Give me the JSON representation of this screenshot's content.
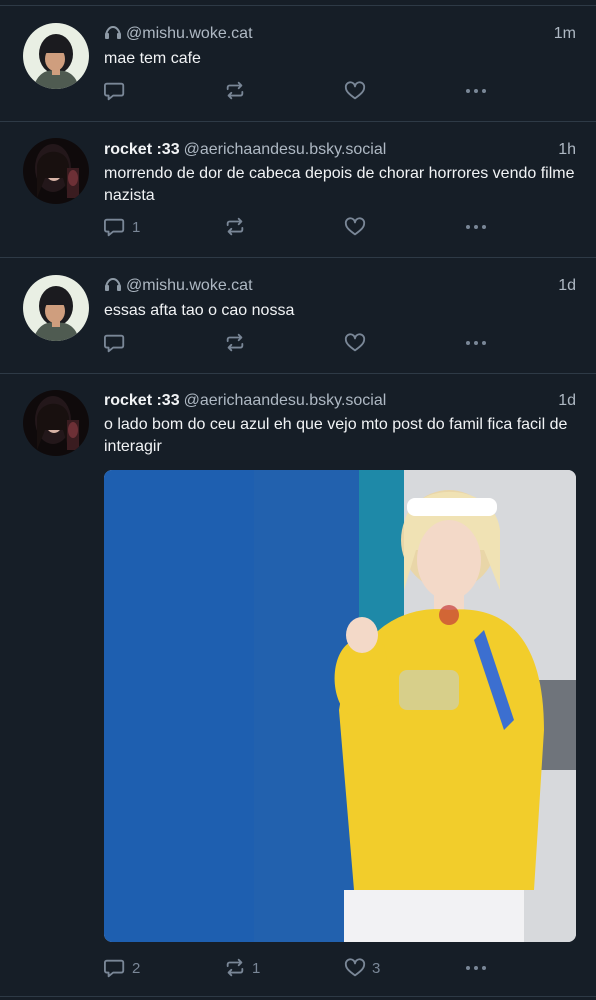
{
  "posts": [
    {
      "display_name": "",
      "handle": "@mishu.woke.cat",
      "time": "1m",
      "text": "mae tem cafe",
      "reply_count": "",
      "repost_count": "",
      "like_count": "",
      "avatar": "avatar-mishu",
      "has_badge_icon": true
    },
    {
      "display_name": "rocket :33",
      "handle": "@aerichaandesu.bsky.social",
      "time": "1h",
      "text": "morrendo de dor de cabeca depois de chorar horrores vendo filme nazista",
      "reply_count": "1",
      "repost_count": "",
      "like_count": "",
      "avatar": "avatar-rocket",
      "has_badge_icon": false
    },
    {
      "display_name": "",
      "handle": "@mishu.woke.cat",
      "time": "1d",
      "text": "essas afta tao o cao nossa",
      "reply_count": "",
      "repost_count": "",
      "like_count": "",
      "avatar": "avatar-mishu",
      "has_badge_icon": true
    },
    {
      "display_name": "rocket :33",
      "handle": "@aerichaandesu.bsky.social",
      "time": "1d",
      "text": "o lado bom do ceu azul eh que vejo mto post do famil fica facil de interagir",
      "reply_count": "2",
      "repost_count": "1",
      "like_count": "3",
      "avatar": "avatar-rocket",
      "has_badge_icon": false,
      "media": "gif-image"
    }
  ],
  "icons": {
    "reply": "reply-icon",
    "repost": "repost-icon",
    "like": "heart-icon",
    "more": "more-icon"
  },
  "colors": {
    "background": "#161e27",
    "divider": "#2e3a46",
    "text": "#f1f3f5",
    "muted": "#aeb8c3",
    "icon": "#7a8797"
  }
}
